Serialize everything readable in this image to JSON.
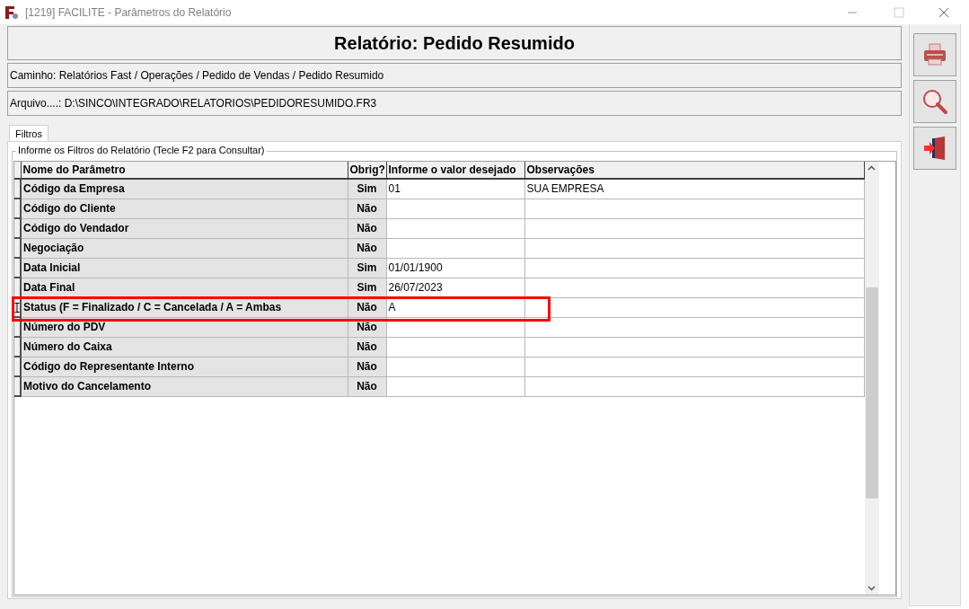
{
  "window": {
    "title": "[1219] FACILITE - Parâmetros do Relatório"
  },
  "header": {
    "title": "Relatório: Pedido Resumido",
    "path": "Caminho: Relatórios Fast / Operações / Pedido de Vendas / Pedido Resumido",
    "file": "Arquivo....: D:\\SINCO\\INTEGRADO\\RELATORIOS\\PEDIDORESUMIDO.FR3"
  },
  "tabs": [
    {
      "label": "Filtros",
      "selected": true
    }
  ],
  "group": {
    "label": "Informe os Filtros do Relatório (Tecle F2 para Consultar)"
  },
  "table": {
    "columns": [
      "Nome do Parâmetro",
      "Obrig?",
      "Informe o valor desejado",
      "Observações"
    ],
    "rows": [
      {
        "name": "Código da Empresa",
        "required": "Sim",
        "value": "01",
        "notes": "SUA EMPRESA",
        "current": false,
        "highlighted": false
      },
      {
        "name": "Código do Cliente",
        "required": "Não",
        "value": "",
        "notes": "",
        "current": false,
        "highlighted": false
      },
      {
        "name": "Código do Vendador",
        "required": "Não",
        "value": "",
        "notes": "",
        "current": false,
        "highlighted": false
      },
      {
        "name": "Negociação",
        "required": "Não",
        "value": "",
        "notes": "",
        "current": false,
        "highlighted": false
      },
      {
        "name": "Data Inicial",
        "required": "Sim",
        "value": "01/01/1900",
        "notes": "",
        "current": false,
        "highlighted": false
      },
      {
        "name": "Data Final",
        "required": "Sim",
        "value": "26/07/2023",
        "notes": "",
        "current": false,
        "highlighted": false
      },
      {
        "name": "Status (F = Finalizado / C = Cancelada / A = Ambas",
        "required": "Não",
        "value": "A",
        "notes": "",
        "current": true,
        "highlighted": true
      },
      {
        "name": "Número do PDV",
        "required": "Não",
        "value": "",
        "notes": "",
        "current": false,
        "highlighted": false
      },
      {
        "name": "Número do Caixa",
        "required": "Não",
        "value": "",
        "notes": "",
        "current": false,
        "highlighted": false
      },
      {
        "name": "Código do Representante Interno",
        "required": "Não",
        "value": "",
        "notes": "",
        "current": false,
        "highlighted": false
      },
      {
        "name": "Motivo do Cancelamento",
        "required": "Não",
        "value": "",
        "notes": "",
        "current": false,
        "highlighted": false
      }
    ]
  },
  "side_buttons": [
    {
      "kind": "print"
    },
    {
      "kind": "search"
    },
    {
      "kind": "exit"
    }
  ]
}
